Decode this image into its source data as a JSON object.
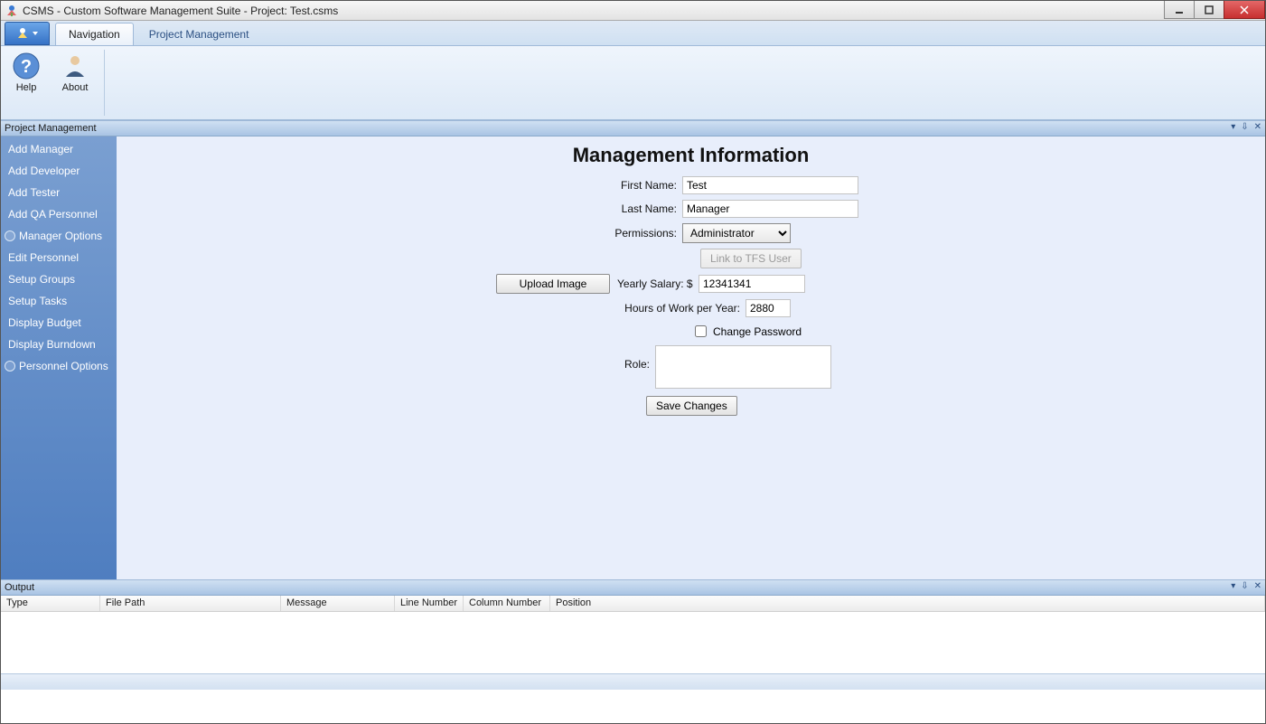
{
  "window": {
    "title": "CSMS - Custom Software Management Suite - Project: Test.csms"
  },
  "ribbon": {
    "tabs": [
      {
        "label": "Navigation",
        "active": true
      },
      {
        "label": "Project Management",
        "active": false
      }
    ],
    "items": {
      "help": "Help",
      "about": "About"
    }
  },
  "panel": {
    "title": "Project Management"
  },
  "sidebar": {
    "items": [
      {
        "label": "Add Manager",
        "type": "item"
      },
      {
        "label": "Add Developer",
        "type": "item"
      },
      {
        "label": "Add Tester",
        "type": "item"
      },
      {
        "label": "Add QA Personnel",
        "type": "item"
      },
      {
        "label": "Manager Options",
        "type": "radio"
      },
      {
        "label": "Edit Personnel",
        "type": "item"
      },
      {
        "label": "Setup Groups",
        "type": "item"
      },
      {
        "label": "Setup Tasks",
        "type": "item"
      },
      {
        "label": "Display Budget",
        "type": "item"
      },
      {
        "label": "Display Burndown",
        "type": "item"
      },
      {
        "label": "Personnel Options",
        "type": "radio"
      }
    ]
  },
  "page": {
    "title": "Management Information"
  },
  "form": {
    "first_name": {
      "label": "First Name:",
      "value": "Test"
    },
    "last_name": {
      "label": "Last Name:",
      "value": "Manager"
    },
    "permissions": {
      "label": "Permissions:",
      "value": "Administrator"
    },
    "link_tfs": {
      "label": "Link to TFS User"
    },
    "upload_image": {
      "label": "Upload Image"
    },
    "yearly_salary": {
      "label": "Yearly Salary: $",
      "value": "12341341"
    },
    "hours_per_year": {
      "label": "Hours of Work per Year:",
      "value": "2880"
    },
    "change_password": {
      "label": "Change Password"
    },
    "role": {
      "label": "Role:",
      "value": ""
    },
    "save": {
      "label": "Save Changes"
    }
  },
  "output": {
    "title": "Output",
    "columns": [
      "Type",
      "File Path",
      "Message",
      "Line Number",
      "Column Number",
      "Position"
    ]
  }
}
